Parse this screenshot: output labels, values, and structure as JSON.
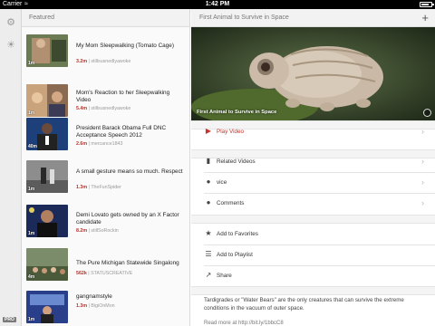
{
  "status_bar": {
    "carrier": "Carrier",
    "time": "1:42 PM",
    "battery_level": 0.8
  },
  "rail": {
    "icons": [
      "gear-icon",
      "sun-icon"
    ],
    "badge": "PRO"
  },
  "feed": {
    "header": "Featured",
    "items": [
      {
        "title": "My Mom Sleepwalking (Tomato Cage)",
        "views": "3.2m",
        "channel": "stillsusnedlyawoke",
        "duration": "1m"
      },
      {
        "title": "Mom's Reaction to her Sleepwalking Video",
        "views": "5.4m",
        "channel": "stillsusnedlyawoke",
        "duration": "1m"
      },
      {
        "title": "President Barack Obama Full DNC Acceptance Speech 2012",
        "views": "2.6m",
        "channel": "mercance1843",
        "duration": "40m"
      },
      {
        "title": "A small gesture means so much. Respect",
        "views": "1.3m",
        "channel": "TheFunSpider",
        "duration": "1m"
      },
      {
        "title": "Demi Lovato gets owned by an X Factor candidate",
        "views": "8.2m",
        "channel": "stillSoRockin",
        "duration": "1m"
      },
      {
        "title": "The Pure Michigan Statewide Singalong",
        "views": "562k",
        "channel": "STATUSCREATIVE",
        "duration": "4m"
      },
      {
        "title": "gangnamstyle",
        "views": "1.3m",
        "channel": "BigiOnMon",
        "duration": "1m"
      }
    ]
  },
  "detail": {
    "title": "First Animal to Survive in Space",
    "hero_caption": "First Animal to Survive in Space",
    "actions": {
      "play": "Play Video",
      "related": "Related Videos",
      "channel": "vice",
      "comments": "Comments",
      "favorites": "Add to Favorites",
      "playlist": "Add to Playlist",
      "share": "Share"
    },
    "description": "Tardigrades or \"Water Bears\" are the only creatures that can survive the extreme conditions in the vacuum of outer space.",
    "description_more": "Read more at http://bit.ly/1bbcC8"
  },
  "colors": {
    "accent": "#c6332c",
    "views": "#b4322c"
  }
}
